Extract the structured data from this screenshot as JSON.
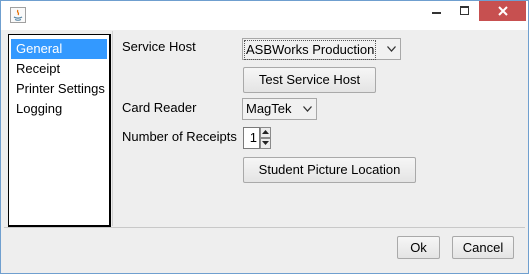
{
  "sidebar": {
    "items": [
      {
        "label": "General",
        "selected": true
      },
      {
        "label": "Receipt",
        "selected": false
      },
      {
        "label": "Printer Settings",
        "selected": false
      },
      {
        "label": "Logging",
        "selected": false
      }
    ]
  },
  "general": {
    "service_host_label": "Service Host",
    "service_host_value": "ASBWorks Production",
    "test_service_host_button": "Test Service Host",
    "card_reader_label": "Card Reader",
    "card_reader_value": "MagTek",
    "receipts_label": "Number of Receipts",
    "receipts_value": "1",
    "student_picture_button": "Student Picture Location"
  },
  "footer": {
    "ok_button": "Ok",
    "cancel_button": "Cancel"
  },
  "colors": {
    "selection": "#3399ff",
    "close_button": "#c75050",
    "window_border": "#6f9fcf"
  },
  "icons": [
    "java-app-icon",
    "minimize-icon",
    "maximize-icon",
    "close-icon",
    "dropdown-arrow-icon",
    "spinner-up-icon",
    "spinner-down-icon"
  ]
}
